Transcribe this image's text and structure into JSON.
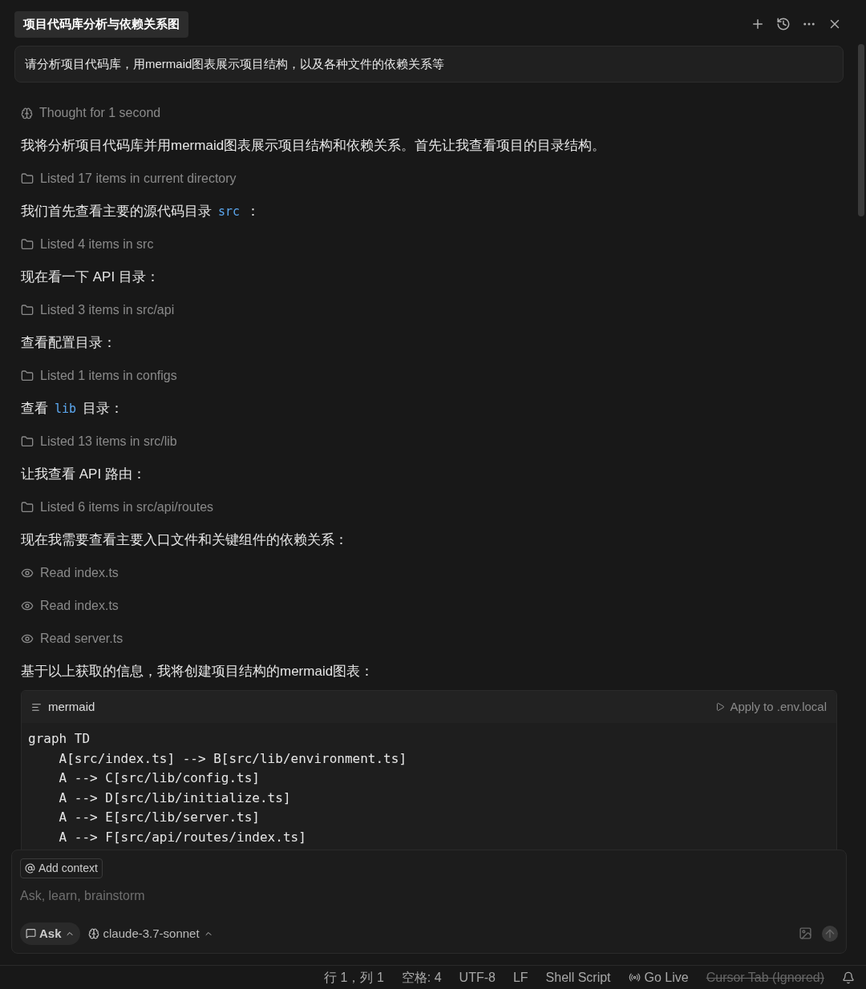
{
  "tab": {
    "title": "项目代码库分析与依赖关系图",
    "selected": true
  },
  "prompt": "请分析项目代码库，用mermaid图表展示项目结构，以及各种文件的依赖关系等",
  "messages": [
    {
      "kind": "thought",
      "text": "Thought for 1 second"
    },
    {
      "kind": "text",
      "segments": [
        {
          "text": "我将分析项目代码库并用mermaid图表展示项目结构和依赖关系。首先让我查看项目的目录结构。",
          "kind": "plain"
        }
      ]
    },
    {
      "kind": "folder",
      "text": "Listed 17 items in current directory"
    },
    {
      "kind": "text",
      "segments": [
        {
          "text": "我们首先查看主要的源代码目录",
          "kind": "plain"
        },
        {
          "text": "src",
          "kind": "code"
        },
        {
          "text": "：",
          "kind": "plain"
        }
      ]
    },
    {
      "kind": "folder",
      "text": "Listed 4 items in src"
    },
    {
      "kind": "text",
      "segments": [
        {
          "text": "现在看一下 API 目录：",
          "kind": "plain"
        }
      ]
    },
    {
      "kind": "folder",
      "text": "Listed 3 items in src/api"
    },
    {
      "kind": "text",
      "segments": [
        {
          "text": "查看配置目录：",
          "kind": "plain"
        }
      ]
    },
    {
      "kind": "folder",
      "text": "Listed 1 items in configs"
    },
    {
      "kind": "text",
      "segments": [
        {
          "text": "查看",
          "kind": "plain"
        },
        {
          "text": "lib",
          "kind": "code"
        },
        {
          "text": "目录：",
          "kind": "plain"
        }
      ]
    },
    {
      "kind": "folder",
      "text": "Listed 13 items in src/lib"
    },
    {
      "kind": "text",
      "segments": [
        {
          "text": "让我查看 API 路由：",
          "kind": "plain"
        }
      ]
    },
    {
      "kind": "folder",
      "text": "Listed 6 items in src/api/routes"
    },
    {
      "kind": "text",
      "segments": [
        {
          "text": "现在我需要查看主要入口文件和关键组件的依赖关系：",
          "kind": "plain"
        }
      ]
    },
    {
      "kind": "read",
      "text": "Read index.ts"
    },
    {
      "kind": "read",
      "text": "Read index.ts"
    },
    {
      "kind": "read",
      "text": "Read server.ts"
    },
    {
      "kind": "text",
      "segments": [
        {
          "text": "基于以上获取的信息，我将创建项目结构的mermaid图表：",
          "kind": "plain"
        }
      ]
    }
  ],
  "code_block": {
    "language": "mermaid",
    "action": "Apply to .env.local",
    "lines": [
      "graph TD",
      "    A[src/index.ts] --> B[src/lib/environment.ts]",
      "    A --> C[src/lib/config.ts]",
      "    A --> D[src/lib/initialize.ts]",
      "    A --> E[src/lib/server.ts]",
      "    A --> F[src/api/routes/index.ts]"
    ]
  },
  "composer": {
    "context_button": "Add context",
    "placeholder": "Ask, learn, brainstorm",
    "mode": "Ask",
    "model": "claude-3.7-sonnet"
  },
  "status_bar": [
    {
      "text": "行 1，列 1",
      "struck": false
    },
    {
      "text": "空格: 4",
      "struck": false
    },
    {
      "text": "UTF-8",
      "struck": false
    },
    {
      "text": "LF",
      "struck": false
    },
    {
      "text": "Shell Script",
      "struck": false
    },
    {
      "text": "Go Live",
      "struck": false,
      "kind": "live"
    },
    {
      "text": "Cursor Tab (Ignored)",
      "struck": true
    }
  ]
}
